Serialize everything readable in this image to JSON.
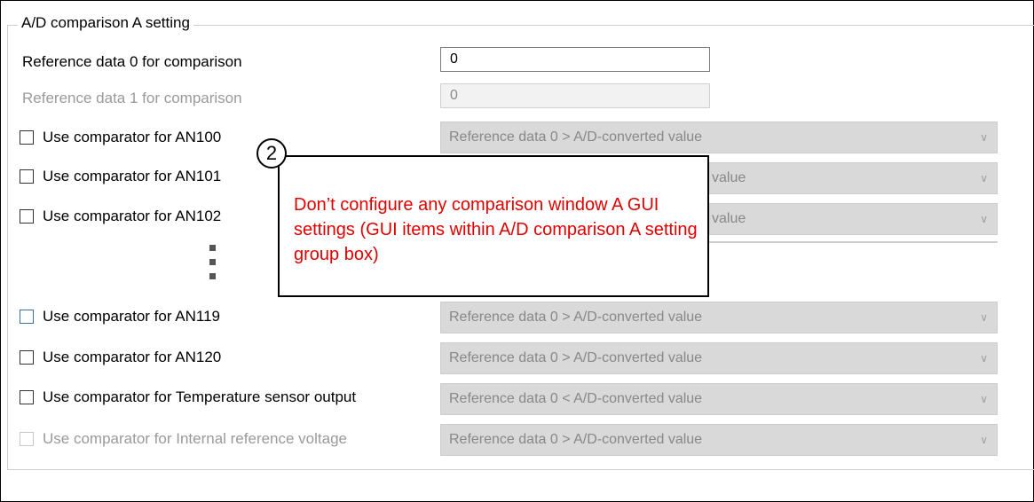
{
  "group": {
    "title": "A/D comparison A setting"
  },
  "ref0": {
    "label": "Reference data 0 for comparison",
    "value": "0"
  },
  "ref1": {
    "label": "Reference data 1 for comparison",
    "value": "0"
  },
  "rows": [
    {
      "label": "Use comparator for AN100",
      "select": "Reference data 0 > A/D-converted value"
    },
    {
      "label": "Use comparator for AN101",
      "select": "value"
    },
    {
      "label": "Use comparator for AN102",
      "select": "value"
    },
    {
      "label": "Use comparator for AN119",
      "select": "Reference data 0 > A/D-converted value"
    },
    {
      "label": "Use comparator for AN120",
      "select": "Reference data 0 > A/D-converted value"
    },
    {
      "label": "Use comparator for Temperature sensor output",
      "select": "Reference data 0 < A/D-converted value"
    },
    {
      "label": "Use comparator for Internal reference voltage",
      "select": "Reference data 0 > A/D-converted value"
    }
  ],
  "callout": {
    "number": "2",
    "text": "Don’t configure any comparison window A GUI settings (GUI items within A/D comparison A setting group box)"
  },
  "icons": {
    "dropdown": "chevron-down-icon",
    "checkbox": "checkbox-icon"
  },
  "colors": {
    "callout_text": "#e00000",
    "disabled_field": "#d9d9d9"
  }
}
